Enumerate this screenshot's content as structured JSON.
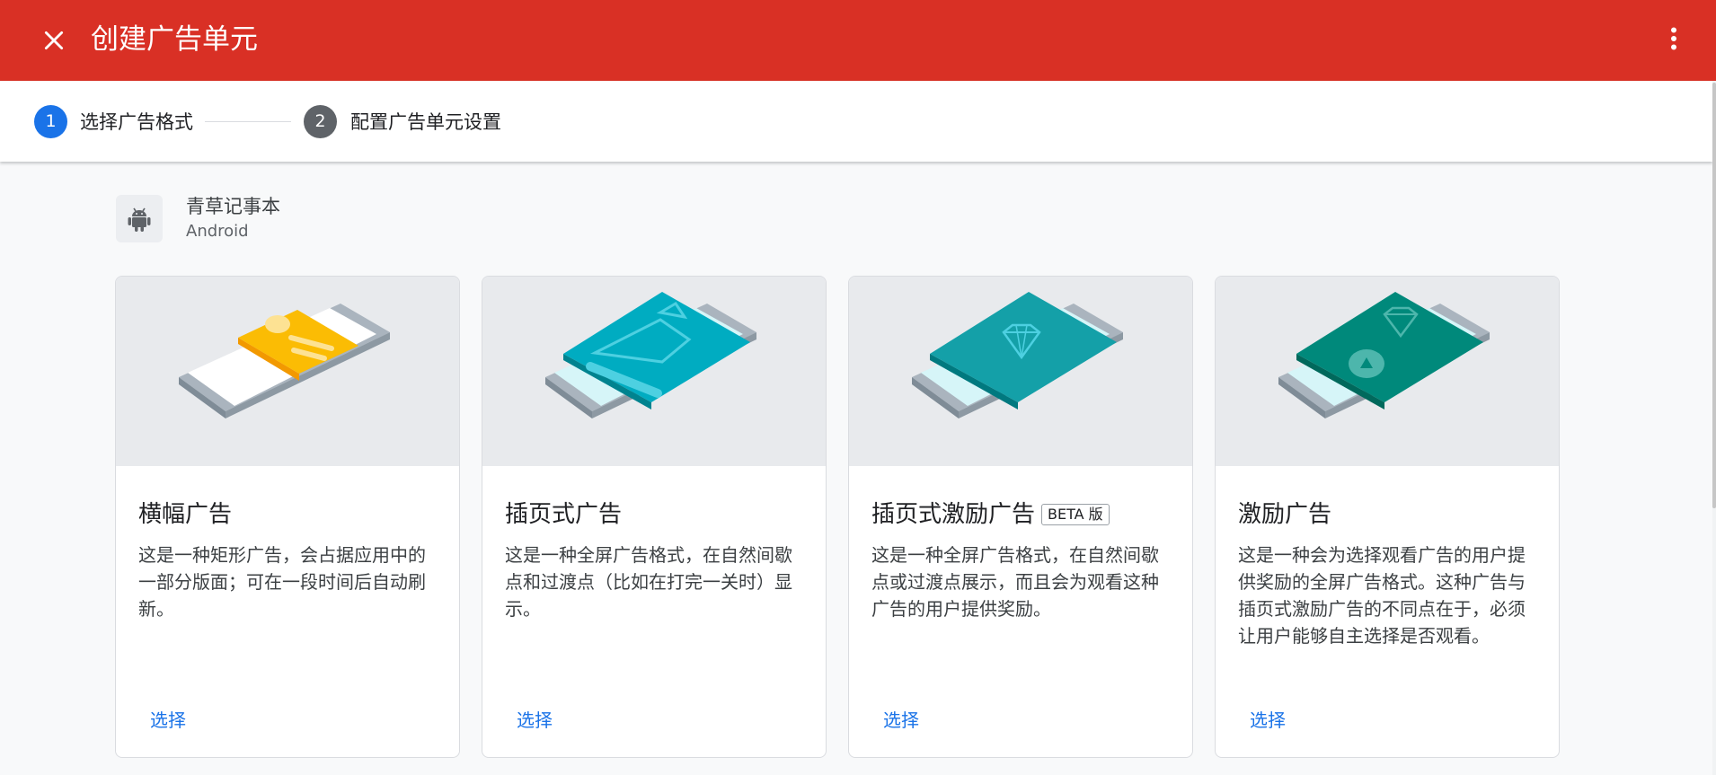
{
  "header": {
    "title": "创建广告单元",
    "close_icon": "close-icon",
    "more_icon": "more-vert-icon",
    "background_color": "#d93025"
  },
  "stepper": {
    "steps": [
      {
        "number": "1",
        "label": "选择广告格式",
        "state": "active"
      },
      {
        "number": "2",
        "label": "配置广告单元设置",
        "state": "inactive"
      }
    ],
    "active_color": "#1a73e8",
    "inactive_color": "#5f6368"
  },
  "app": {
    "name": "青草记事本",
    "platform": "Android",
    "icon": "android-icon"
  },
  "cards": [
    {
      "title": "横幅广告",
      "badge": null,
      "description": "这是一种矩形广告，会占据应用中的一部分版面；可在一段时间后自动刷新。",
      "action": "选择",
      "illustration": "banner-ad-illustration"
    },
    {
      "title": "插页式广告",
      "badge": null,
      "description": "这是一种全屏广告格式，在自然间歇点和过渡点（比如在打完一关时）显示。",
      "action": "选择",
      "illustration": "interstitial-ad-illustration"
    },
    {
      "title": "插页式激励广告",
      "badge": "BETA 版",
      "description": "这是一种全屏广告格式，在自然间歇点或过渡点展示，而且会为观看这种广告的用户提供奖励。",
      "action": "选择",
      "illustration": "rewarded-interstitial-illustration"
    },
    {
      "title": "激励广告",
      "badge": null,
      "description": "这是一种会为选择观看广告的用户提供奖励的全屏广告格式。这种广告与插页式激励广告的不同点在于，必须让用户能够自主选择是否观看。",
      "action": "选择",
      "illustration": "rewarded-ad-illustration"
    }
  ]
}
